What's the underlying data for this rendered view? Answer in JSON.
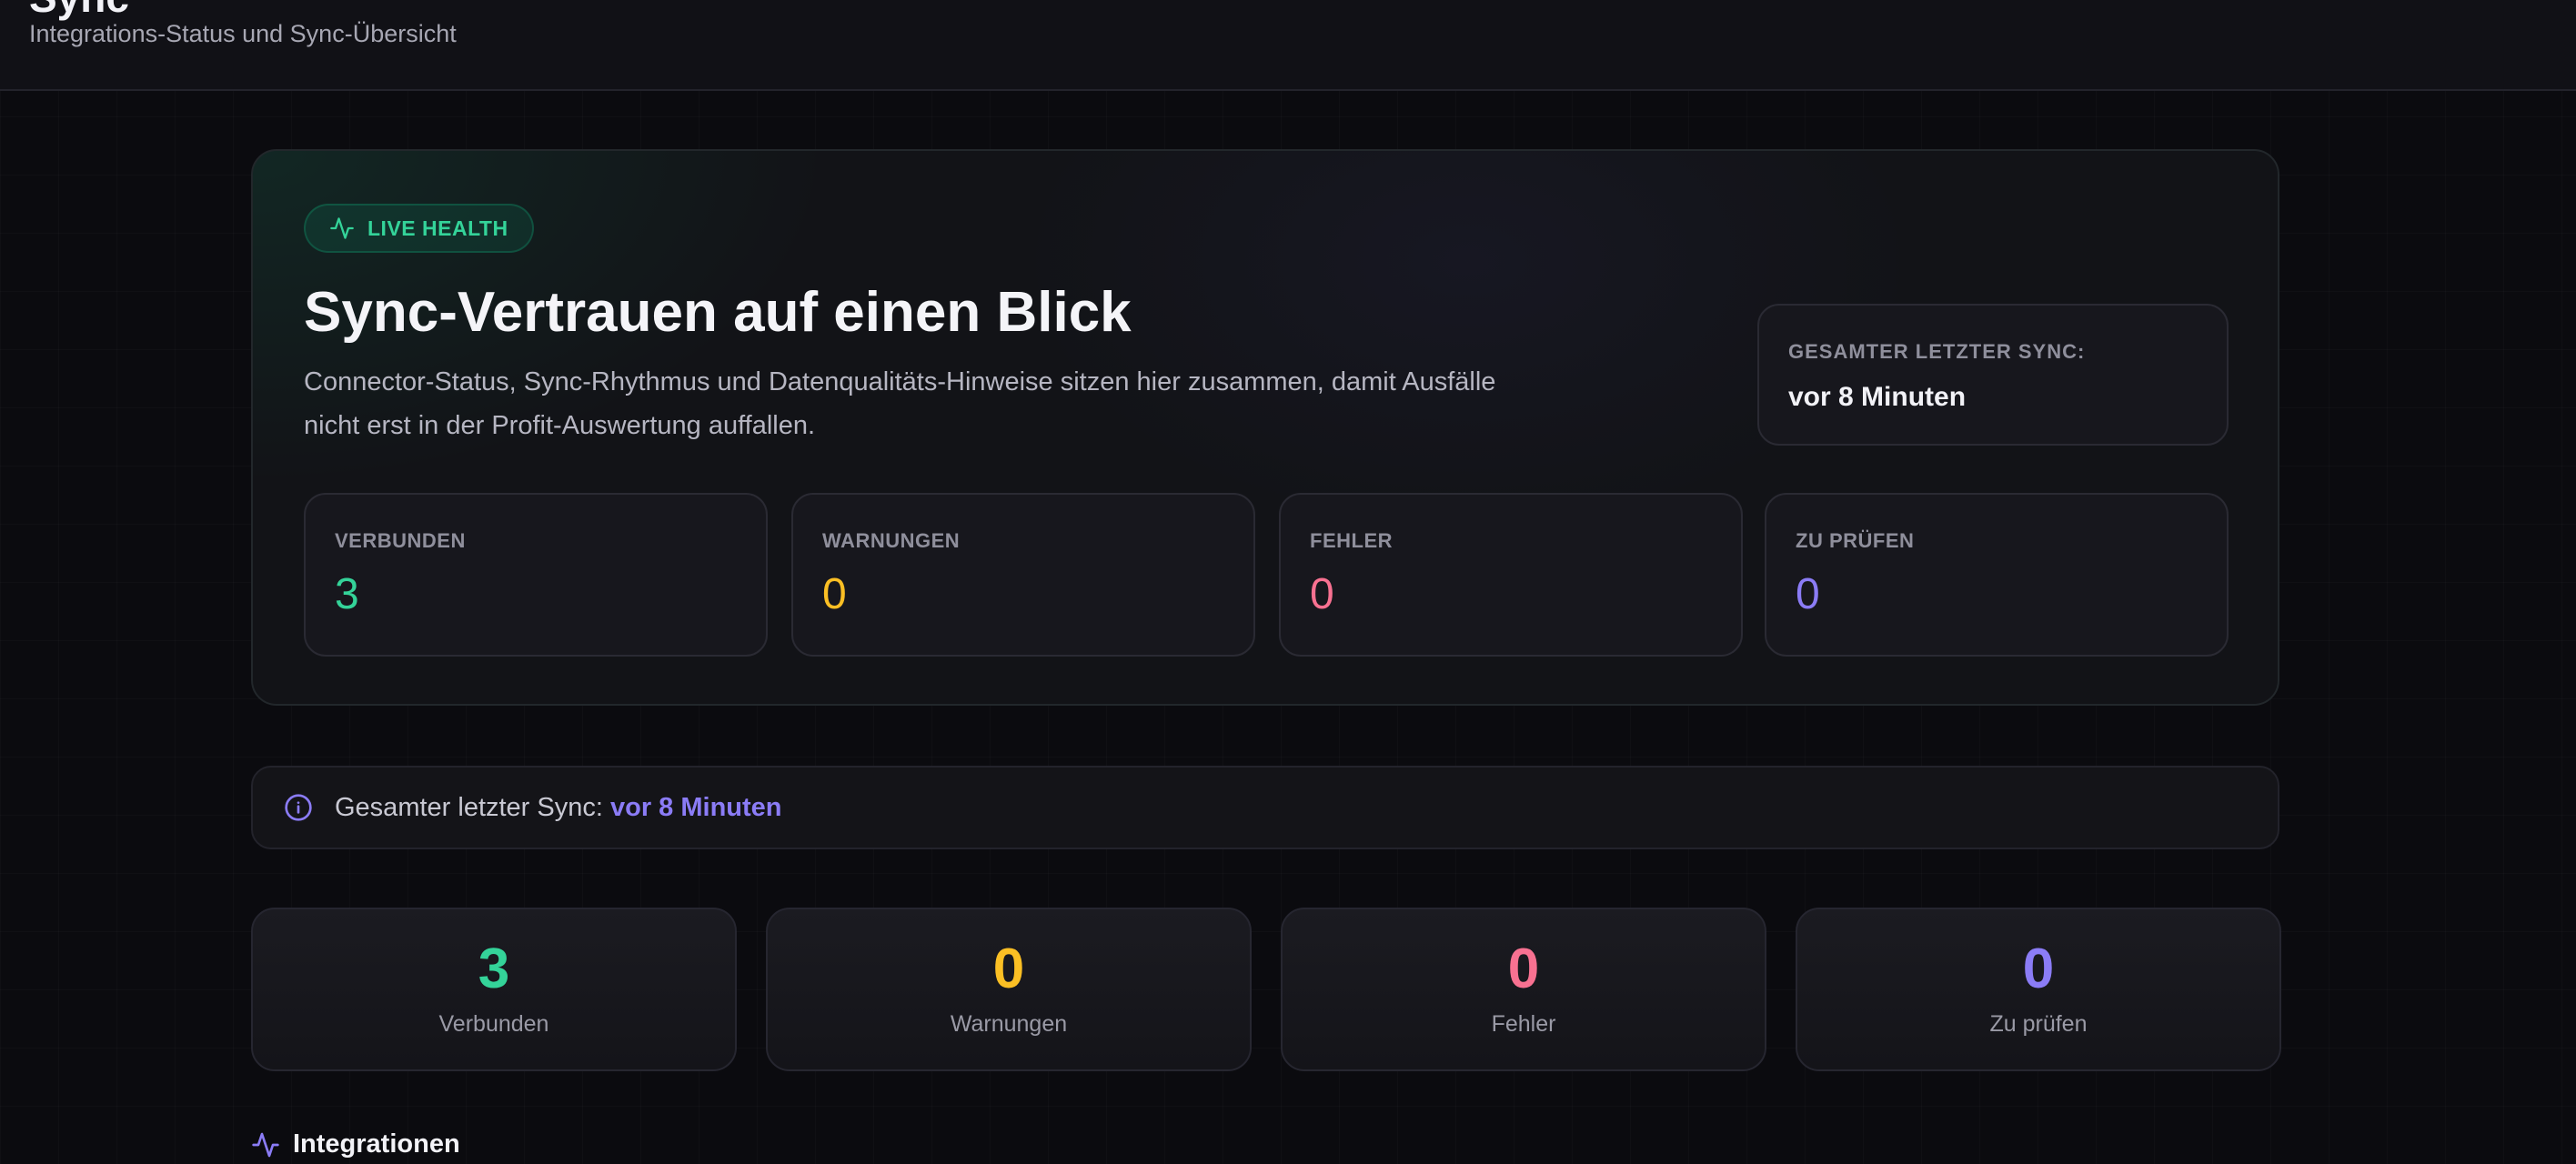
{
  "header": {
    "title": "Sync",
    "subtitle": "Integrations-Status und Sync-Übersicht"
  },
  "hero": {
    "badge": "LIVE HEALTH",
    "title": "Sync-Vertrauen auf einen Blick",
    "description": "Connector-Status, Sync-Rhythmus und Datenqualitäts-Hinweise sitzen hier zusammen, damit Ausfälle nicht erst in der Profit-Auswertung auffallen.",
    "last_sync": {
      "label": "GESAMTER LETZTER SYNC:",
      "value": "vor 8 Minuten"
    },
    "stats": [
      {
        "label": "VERBUNDEN",
        "value": "3",
        "color": "#34d399"
      },
      {
        "label": "WARNUNGEN",
        "value": "0",
        "color": "#fbbf24"
      },
      {
        "label": "FEHLER",
        "value": "0",
        "color": "#f87191"
      },
      {
        "label": "ZU PRÜFEN",
        "value": "0",
        "color": "#8b7cf6"
      }
    ]
  },
  "info_bar": {
    "icon": "info-icon",
    "text": "Gesamter letzter Sync:",
    "highlight": "vor 8 Minuten"
  },
  "summary_cards": [
    {
      "value": "3",
      "label": "Verbunden",
      "color": "#34d399"
    },
    {
      "value": "0",
      "label": "Warnungen",
      "color": "#fbbf24"
    },
    {
      "value": "0",
      "label": "Fehler",
      "color": "#f87191"
    },
    {
      "value": "0",
      "label": "Zu prüfen",
      "color": "#8b7cf6"
    }
  ],
  "section": {
    "icon": "activity-icon",
    "title": "Integrationen"
  }
}
